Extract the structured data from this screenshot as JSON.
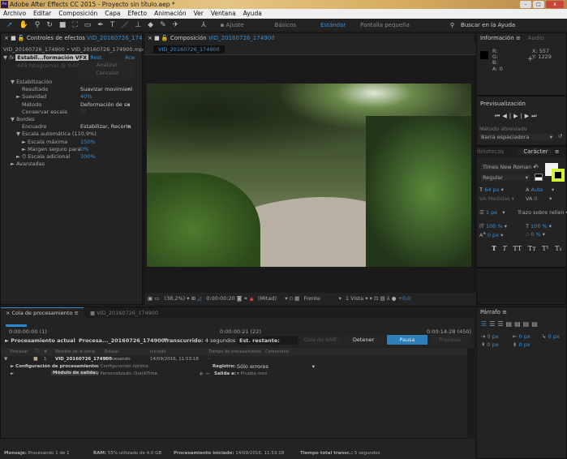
{
  "window": {
    "title": "Adobe After Effects CC 2015 - Proyecto sin título.aep *",
    "logo": "Ae",
    "controls": [
      "–",
      "□",
      "x"
    ]
  },
  "menu": [
    "Archivo",
    "Editar",
    "Composición",
    "Capa",
    "Efecto",
    "Animación",
    "Ver",
    "Ventana",
    "Ayuda"
  ],
  "toolbar": {
    "tools": [
      "selection-icon",
      "hand-icon",
      "zoom-icon",
      "rotate-icon",
      "camera-icon",
      "pan-behind-icon",
      "rectangle-icon",
      "pen-icon",
      "type-icon",
      "brush-icon",
      "clone-stamp-icon",
      "eraser-icon",
      "roto-brush-icon",
      "puppet-icon"
    ],
    "snap_label": "Ajuste",
    "workspaces": [
      "Básicos",
      "Estándar",
      "Pantalla pequeña"
    ],
    "active_workspace": "Estándar",
    "search": "Buscar en la Ayuda"
  },
  "effects": {
    "title": "Controles de efectos",
    "layer": "VID_20160726_1749",
    "path": "VID_20160726_174900 • VID_20160726_174900.mp4",
    "effect_name": "Estabil...formación VFX",
    "reset": "Rest.",
    "about": "Ace",
    "frames_note": "449 fotogramas @ 0:00:00;",
    "analyze": "Analizar",
    "cancel": "Cancelar",
    "props": [
      {
        "label": "▼ Estabilización",
        "indent": 0
      },
      {
        "label": "Resultado",
        "indent": 2,
        "value": "Suavizar movimient",
        "dropdown": true
      },
      {
        "label": "► Suavidad",
        "indent": 1,
        "value": "40%",
        "blue": true
      },
      {
        "label": "Método",
        "indent": 2,
        "value": "Deformación de su",
        "dropdown": true
      },
      {
        "label": "Conservar escala",
        "indent": 2,
        "value": "",
        "checkbox": true
      },
      {
        "label": "▼ Bordes",
        "indent": 0
      },
      {
        "label": "Encuadre",
        "indent": 2,
        "value": "Estabilizar, Recorta",
        "dropdown": true
      },
      {
        "label": "▼ Escala automática (110,9%)",
        "indent": 1
      },
      {
        "label": "► Escala máxima",
        "indent": 2,
        "value": "150%",
        "blue": true
      },
      {
        "label": "► Margen seguro para",
        "indent": 2,
        "value": "0%",
        "blue": true
      },
      {
        "label": "► ⏱ Escala adicional",
        "indent": 1,
        "value": "100%",
        "blue": true
      },
      {
        "label": "► Avanzadas",
        "indent": 0
      }
    ]
  },
  "composition": {
    "title": "Composición",
    "name": "VID_20160726_174900",
    "tab": "VID_20160726_174900",
    "zoom": "(38,2%)",
    "timecode": "0:00:00:20",
    "resolution": "(Mitad)",
    "view": "Frente",
    "views": "1 Vista",
    "exposure": "+0,0"
  },
  "info": {
    "tab": "Información",
    "tab2": "Audio",
    "r": "R:",
    "g": "G:",
    "b": "B:",
    "a": "A:  0",
    "x": "X:  557",
    "y": "Y:  1229"
  },
  "preview": {
    "title": "Previsualización",
    "buttons": [
      "⏮",
      "◀|",
      "▶",
      "|▶",
      "⏭"
    ],
    "shortcut_label": "Método abreviado",
    "shortcut_value": "Barra espaciadora"
  },
  "character": {
    "tab1": "ibliotecas",
    "tab2": "Carácter",
    "font": "Times New Roman",
    "style": "Regular",
    "size": "64 px",
    "leading": "Auto",
    "kerning": "Medidas",
    "tracking": "0",
    "stroke": "1 px",
    "stroke_mode": "Trazo sobre rellen",
    "vscale": "100 %",
    "hscale": "100 %",
    "baseline": "0 px",
    "tsume": "0 %",
    "styles": [
      "T",
      "T",
      "TT",
      "Tт",
      "T¹",
      "T₁"
    ],
    "stroke_color": "#000000",
    "fill_color": "#f2f2f2"
  },
  "paragraph": {
    "title": "Párrafo",
    "indents": [
      "0 px",
      "0 px",
      "0 px",
      "0 px",
      "0 px"
    ]
  },
  "render_queue": {
    "tab": "Cola de procesamiento",
    "tab2": "VID_20160726_174900",
    "progress": 0.05,
    "time_start": "0:00:00:00 (1)",
    "time_mid": "0:00:00:21 (22)",
    "time_end": "0:00:14:28 (450)",
    "current_label": "Procesamiento actual",
    "current_value": "Procesa..._20160726_174900\"",
    "elapsed_label": "Transcurrido:",
    "elapsed": "4 segundos",
    "remaining_label": "Est. restante:",
    "ame": "Cola de AME",
    "stop": "Detener",
    "pause": "Pausa",
    "render": "Procesar",
    "columns": [
      "Procesar",
      "🏷",
      "#",
      "Nombre de la comp.",
      "Estado",
      "Iniciado",
      "Tiempo de procesamiento",
      "Comentario"
    ],
    "item": {
      "num": "1",
      "name": "VID_20160726_174900",
      "status": "Procesando",
      "started": "14/09/2016, 11:53:18",
      "time": "-"
    },
    "settings_label": "Configuración de procesamiento:",
    "settings_value": "Configuración óptima",
    "log_label": "Registro:",
    "log_value": "Sólo errores",
    "output_label": "Módulo de salida:",
    "output_value": "Personalizado: QuickTime",
    "output_to_label": "Salida a:",
    "output_to_value": "Prueba.mov"
  },
  "status": {
    "message_label": "Mensaje:",
    "message": "Procesando 1 de 1",
    "ram_label": "RAM:",
    "ram": "55% utilizado de 4,0 GB",
    "started_label": "Procesamiento iniciado:",
    "started": "14/09/2016, 11:53:18",
    "total_label": "Tiempo total transc.:",
    "total": "5 segundos"
  },
  "colors": {
    "accent": "#3d8fd1",
    "pause_button": "#2f7fb8",
    "highlight": "#d8f03c"
  }
}
